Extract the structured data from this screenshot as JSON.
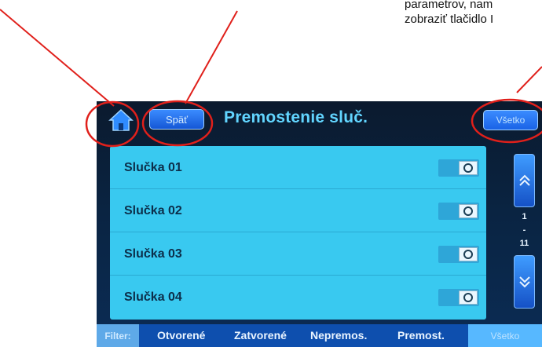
{
  "annotation": {
    "line1": "parametrov, nam",
    "line2": "zobraziť tlačidlo I"
  },
  "header": {
    "home_icon": "home-icon",
    "back_label": "Späť",
    "title": "Premostenie sluč.",
    "right_button_label": "Všetko"
  },
  "loops": [
    {
      "label": "Slučka 01",
      "toggle": "off"
    },
    {
      "label": "Slučka 02",
      "toggle": "off"
    },
    {
      "label": "Slučka 03",
      "toggle": "off"
    },
    {
      "label": "Slučka 04",
      "toggle": "off"
    }
  ],
  "pager": {
    "current": "1",
    "separator": "-",
    "total": "11",
    "up_icon": "double-chevron-up-icon",
    "down_icon": "double-chevron-down-icon"
  },
  "filter": {
    "label": "Filter:",
    "options": [
      "Otvorené",
      "Zatvorené",
      "Nepremos.",
      "Premost."
    ],
    "active": "Všetko"
  },
  "colors": {
    "screen_bg": "#0b2443",
    "list_bg": "#39c9f0",
    "title": "#62d5ff",
    "button": "#2a76f0",
    "annotation_red": "#e0201b",
    "filter_bar": "#0e4fae"
  }
}
